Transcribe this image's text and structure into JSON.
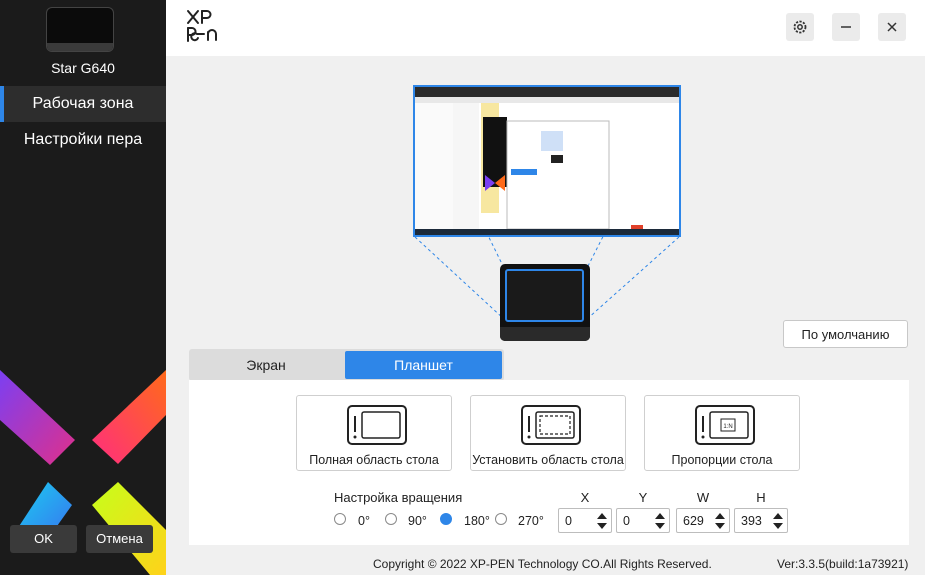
{
  "sidebar": {
    "device_name": "Star G640",
    "items": [
      {
        "label": "Рабочая зона",
        "active": true
      },
      {
        "label": "Настройки пера",
        "active": false
      }
    ],
    "ok_label": "OK",
    "cancel_label": "Отмена"
  },
  "header": {
    "logo_text": "XP-PEN",
    "icons": [
      "gear-icon",
      "minimize-icon",
      "close-icon"
    ]
  },
  "workarea": {
    "default_button": "По умолчанию",
    "tabs": [
      {
        "label": "Экран",
        "active": false
      },
      {
        "label": "Планшет",
        "active": true
      }
    ],
    "options": [
      {
        "label": "Полная область стола",
        "icon": "full-area-icon"
      },
      {
        "label": "Установить область стола",
        "icon": "custom-area-icon"
      },
      {
        "label": "Пропорции стола",
        "icon": "ratio-icon",
        "icon_text": "1:N"
      }
    ],
    "rotation": {
      "title": "Настройка вращения",
      "options": [
        "0°",
        "90°",
        "180°",
        "270°"
      ],
      "selected": "180°"
    },
    "coords": [
      {
        "label": "X",
        "value": "0"
      },
      {
        "label": "Y",
        "value": "0"
      },
      {
        "label": "W",
        "value": "629"
      },
      {
        "label": "H",
        "value": "393"
      }
    ]
  },
  "footer": {
    "copyright": "Copyright © 2022  XP-PEN Technology CO.All Rights Reserved.",
    "version": "Ver:3.3.5(build:1a73921)"
  },
  "colors": {
    "accent": "#2e86e8",
    "sidebar": "#1b1b1b"
  }
}
